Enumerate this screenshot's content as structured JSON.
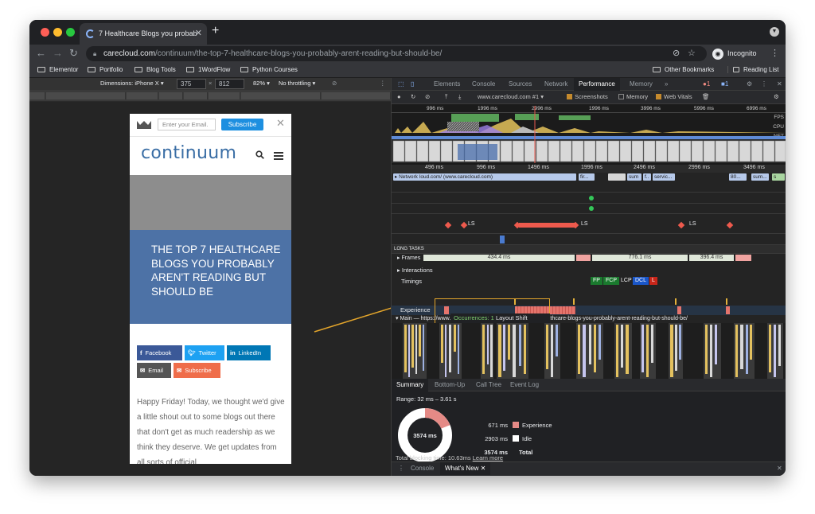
{
  "browser": {
    "tab_title": "7 Healthcare Blogs you probab",
    "url_host": "carecloud.com",
    "url_path": "/continuum/the-top-7-healthcare-blogs-you-probably-arent-reading-but-should-be/",
    "profile": "Incognito",
    "bookmarks": [
      "Elementor",
      "Portfolio",
      "Blog Tools",
      "1WordFlow",
      "Python Courses"
    ],
    "other_bookmarks": "Other Bookmarks",
    "reading_list": "Reading List"
  },
  "device_toolbar": {
    "dimensions_label": "Dimensions: iPhone X",
    "width": "375",
    "times": "×",
    "height": "812",
    "zoom": "82%",
    "throttle": "No throttling"
  },
  "page": {
    "email_placeholder": "Enter your Email.",
    "subscribe_label": "Subscribe",
    "logo": "continuum",
    "hero_title": "THE TOP 7 HEALTHCARE BLOGS YOU PROBABLY AREN'T READING BUT SHOULD BE",
    "share": {
      "facebook": "Facebook",
      "twitter": "Twitter",
      "linkedin": "LinkedIn",
      "email": "Email",
      "subscribe": "Subscribe"
    },
    "body": "Happy Friday! Today, we thought we'd give a little shout out to some blogs out there that don't get as much readership as we think they deserve. We get updates from all sorts of official"
  },
  "devtools": {
    "tabs": [
      "Elements",
      "Console",
      "Sources",
      "Network",
      "Performance",
      "Memory"
    ],
    "active_tab": "Performance",
    "more": "»",
    "errors": "1",
    "messages": "1",
    "recording": "www.carecloud.com #1",
    "screenshots": "Screenshots",
    "memory_cb": "Memory",
    "web_vitals": "Web Vitals",
    "overview_ticks": [
      "996 ms",
      "1996 ms",
      "2996 ms",
      "3996 ms",
      "4996 ms",
      "5996 ms",
      "6996 ms"
    ],
    "overview_labels": [
      "FPS",
      "CPU",
      "NET"
    ],
    "ruler_ticks": [
      "496 ms",
      "996 ms",
      "1496 ms",
      "1996 ms",
      "2496 ms",
      "2996 ms",
      "3496 ms"
    ],
    "network_label": "Network",
    "network_items": [
      "loud.com/ (www.carecloud.com)",
      "fir...",
      "sum",
      "f..",
      "servic...",
      "80...",
      "sum...",
      "s"
    ],
    "ls_label": "LS",
    "long_tasks": "LONG TASKS",
    "frames_label": "Frames",
    "frames_values": [
      "434.4 ms",
      "776.1 ms",
      "396.4 ms"
    ],
    "interactions": "Interactions",
    "timings": "Timings",
    "timing_badges": [
      "FP",
      "FCP",
      "LCP",
      "DCL",
      "L"
    ],
    "experience": "Experience",
    "tooltip_prefix": "Occurrences: 1",
    "tooltip_text": "Layout Shift",
    "main_thread": "Main — https://www.carecloud.com/continuum/the-top-7-healthcare-blogs-you-probably-arent-reading-but-should-be/",
    "bottom_tabs": [
      "Summary",
      "Bottom-Up",
      "Call Tree",
      "Event Log"
    ],
    "range": "Range: 32 ms – 3.61 s",
    "donut_center": "3574 ms",
    "summary_rows": [
      {
        "value": "671 ms",
        "label": "Experience",
        "color": "#e58a86"
      },
      {
        "value": "2903 ms",
        "label": "Idle",
        "color": "#ffffff"
      },
      {
        "value": "3574 ms",
        "label": "Total",
        "color": ""
      }
    ],
    "blocking_prefix": "Total blocking time: 10.63ms",
    "learn_more": "Learn more",
    "drawer_tabs": [
      "Console",
      "What's New"
    ]
  }
}
